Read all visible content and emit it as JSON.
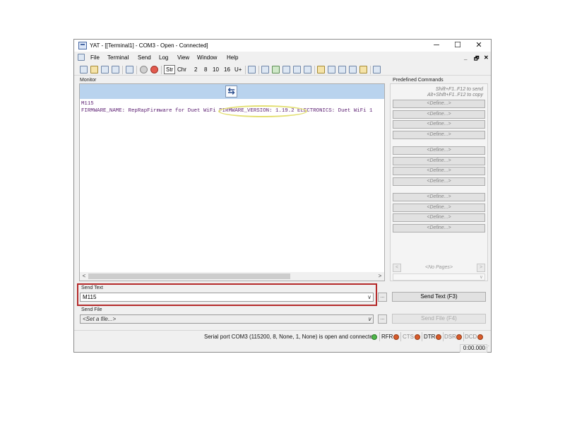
{
  "window": {
    "title": "YAT - [[Terminal1] - COM3 - Open - Connected]",
    "minimize_glyph": "─",
    "maximize_glyph": "☐",
    "close_glyph": "✕",
    "mdi_restore_glyph": "🗗",
    "mdi_close_glyph": "✕",
    "mdi_min_glyph": "_"
  },
  "menu": {
    "items": [
      "File",
      "Terminal",
      "Send",
      "Log",
      "View",
      "Window",
      "Help"
    ]
  },
  "toolbar": {
    "str_label": "Str",
    "chr_label": "Chr",
    "radix": [
      "2",
      "8",
      "10",
      "16",
      "U+"
    ]
  },
  "monitor": {
    "label": "Monitor",
    "swap_glyph": "⇆",
    "lines": [
      "M115",
      "FIRMWARE_NAME: RepRapFirmware for Duet WiFi FIRMWARE_VERSION: 1.19.2 ELECTRONICS: Duet WiFi 1"
    ],
    "scroll_left": "<",
    "scroll_right": ">"
  },
  "predefined": {
    "title": "Predefined Commands",
    "hint_send": "Shift+F1..F12 to send",
    "hint_copy": "Alt+Shift+F1..F12 to copy",
    "define_label": "<Define...>",
    "groups": [
      4,
      4,
      4
    ],
    "no_pages": "<No Pages>",
    "prev": "<",
    "next": ">",
    "combo_arrow": "∨"
  },
  "send_text": {
    "label": "Send Text",
    "value": "M115",
    "dots": "...",
    "button": "Send Text (F3)",
    "arrow": "∨"
  },
  "send_file": {
    "label": "Send File",
    "value": "<Set a file...>",
    "dots": "...",
    "button": "Send File (F4)",
    "arrow": "∨"
  },
  "status": {
    "message": "Serial port COM3 (115200, 8, None, 1, None) is open and connected",
    "signals": [
      {
        "name": "RFR",
        "state": "off"
      },
      {
        "name": "CTS",
        "state": "off"
      },
      {
        "name": "DTR",
        "state": "off"
      },
      {
        "name": "DSR",
        "state": "off"
      },
      {
        "name": "DCD",
        "state": "off"
      }
    ],
    "timer": "0:00.000",
    "colors": {
      "led_on": "#4fb64a",
      "led_off": "#d85b2b",
      "highlight": "#e3df72",
      "send_frame": "#b52a2a"
    }
  }
}
